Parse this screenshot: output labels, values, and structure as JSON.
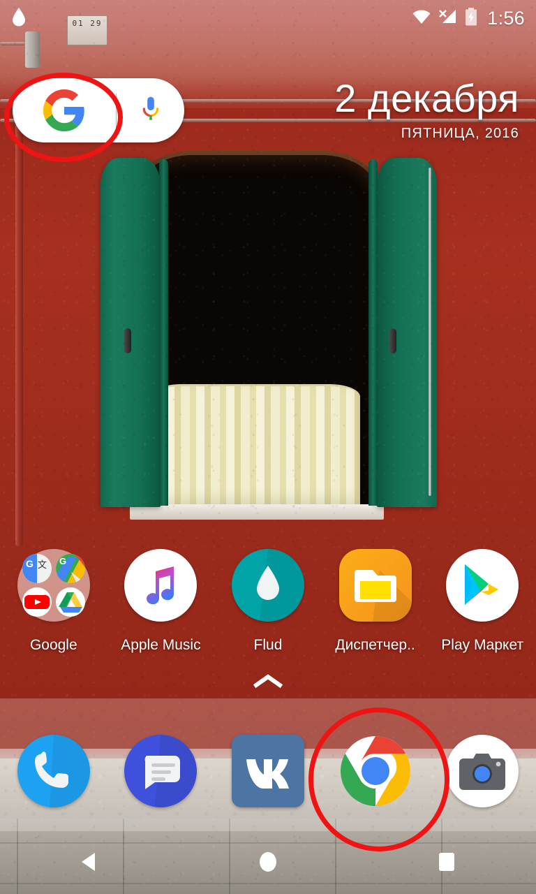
{
  "status_bar": {
    "notification_icons": [
      {
        "name": "water-drop-notification-icon",
        "label": "Flud download"
      }
    ],
    "system_icons": [
      {
        "name": "wifi-icon",
        "label": "Wi-Fi connected"
      },
      {
        "name": "no-sim-signal-icon",
        "label": "No SIM / no signal"
      },
      {
        "name": "battery-charging-icon",
        "label": "Battery charging"
      }
    ],
    "clock": "1:56"
  },
  "search": {
    "google_logo_label": "G",
    "mic_label": "Voice search",
    "placeholder": ""
  },
  "date_widget": {
    "date": "2 декабря",
    "weekday_year": "ПЯТНИЦА, 2016"
  },
  "apps": [
    {
      "label": "Google",
      "icon": "google-folder-icon",
      "folder_items": [
        {
          "label": "Translate",
          "icon": "google-translate-icon"
        },
        {
          "label": "Maps",
          "icon": "google-maps-icon"
        },
        {
          "label": "YouTube",
          "icon": "youtube-icon"
        },
        {
          "label": "Drive",
          "icon": "google-drive-icon"
        }
      ]
    },
    {
      "label": "Apple Music",
      "icon": "apple-music-icon"
    },
    {
      "label": "Flud",
      "icon": "flud-icon"
    },
    {
      "label": "Диспетчер..",
      "icon": "file-manager-icon"
    },
    {
      "label": "Play Маркет",
      "icon": "play-store-icon"
    }
  ],
  "drawer_handle": {
    "label": "Открыть меню приложений",
    "icon": "chevron-up-icon"
  },
  "dock": [
    {
      "label": "Телефон",
      "icon": "phone-icon"
    },
    {
      "label": "Сообщения",
      "icon": "messages-icon"
    },
    {
      "label": "VK",
      "icon": "vk-icon"
    },
    {
      "label": "Chrome",
      "icon": "chrome-icon"
    },
    {
      "label": "Камера",
      "icon": "camera-icon"
    }
  ],
  "nav_bar": [
    {
      "label": "Назад",
      "icon": "back-triangle-icon"
    },
    {
      "label": "Главный экран",
      "icon": "home-circle-icon"
    },
    {
      "label": "Обзор",
      "icon": "recents-square-icon"
    }
  ],
  "annotations": [
    {
      "name": "search-highlight",
      "target": "google-search-logo",
      "color": "#ee1414"
    },
    {
      "name": "chrome-highlight",
      "target": "chrome-dock-icon",
      "color": "#ee1414"
    }
  ],
  "wallpaper": {
    "description": "Красная оштукатуренная стена с зелёными ставнями окна",
    "plaque_text": "01 29"
  },
  "colors": {
    "annotation_red": "#ee1414",
    "wall_red": "#a02c1f",
    "shutter_green": "#147054",
    "dock_overlay": "rgba(255,255,255,0.22)"
  }
}
